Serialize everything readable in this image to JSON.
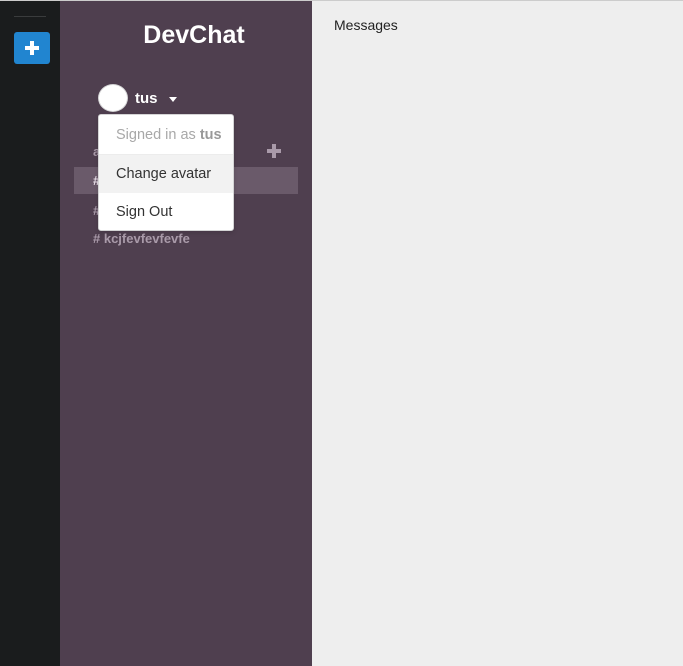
{
  "rail": {
    "add_team_icon": "plus-icon",
    "accent_color": "#2185d0"
  },
  "sidebar": {
    "app_title": "DevChat",
    "user": {
      "name": "tus"
    },
    "channels_label": "a",
    "channels": [
      {
        "label": "#",
        "active": true
      },
      {
        "label": "#",
        "active": false
      },
      {
        "label": "# kcjfevfevfevfe",
        "active": false
      }
    ],
    "background": "#4f3f4f"
  },
  "user_menu": {
    "signed_in_prefix": "Signed in as ",
    "signed_in_user": "tus",
    "items": [
      "Change avatar",
      "Sign Out"
    ]
  },
  "main": {
    "messages_label": "Messages"
  }
}
